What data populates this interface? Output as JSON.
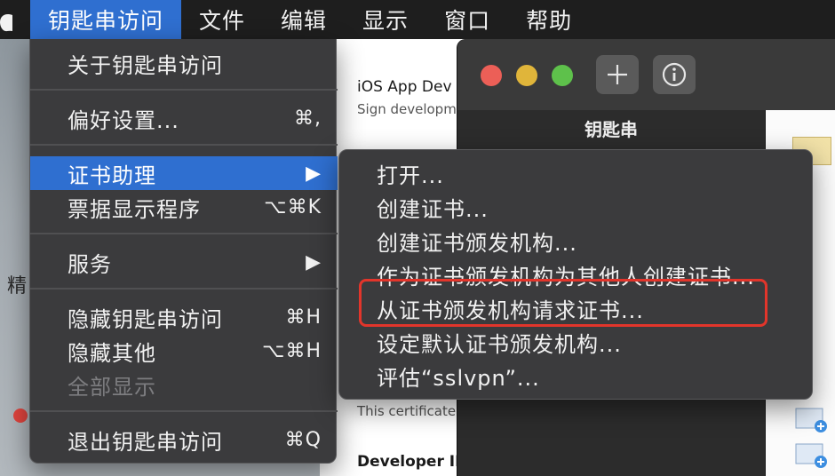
{
  "menubar": {
    "apple_icon": "apple-icon",
    "items": [
      "钥匙串访问",
      "文件",
      "编辑",
      "显示",
      "窗口",
      "帮助"
    ]
  },
  "menu": {
    "items": [
      {
        "label": "关于钥匙串访问",
        "shortcut": ""
      },
      {
        "label": "偏好设置...",
        "shortcut": "⌘,"
      },
      {
        "label": "证书助理",
        "shortcut": "▶"
      },
      {
        "label": "票据显示程序",
        "shortcut": "⌥⌘K"
      },
      {
        "label": "服务",
        "shortcut": "▶"
      },
      {
        "label": "隐藏钥匙串访问",
        "shortcut": "⌘H"
      },
      {
        "label": "隐藏其他",
        "shortcut": "⌥⌘H"
      },
      {
        "label": "全部显示",
        "shortcut": ""
      },
      {
        "label": "退出钥匙串访问",
        "shortcut": "⌘Q"
      }
    ]
  },
  "submenu": {
    "items": [
      "打开...",
      "创建证书...",
      "创建证书颁发机构...",
      "作为证书颁发机构为其他人创建证书...",
      "从证书颁发机构请求证书...",
      "设定默认证书颁发机构...",
      "评估“sslvpn”..."
    ]
  },
  "background": {
    "side_char": "精",
    "doc_lines": [
      "iOS App Dev",
      "Sign developm",
      "This certificate",
      "Developer ID"
    ]
  },
  "keychain_window": {
    "sidebar_title": "钥匙串",
    "add_icon": "plus-icon",
    "info_icon": "info-icon"
  },
  "colors": {
    "menu_bg": "#3b3b3d",
    "highlight": "#2f6fd0",
    "annotation": "#e2352b"
  }
}
